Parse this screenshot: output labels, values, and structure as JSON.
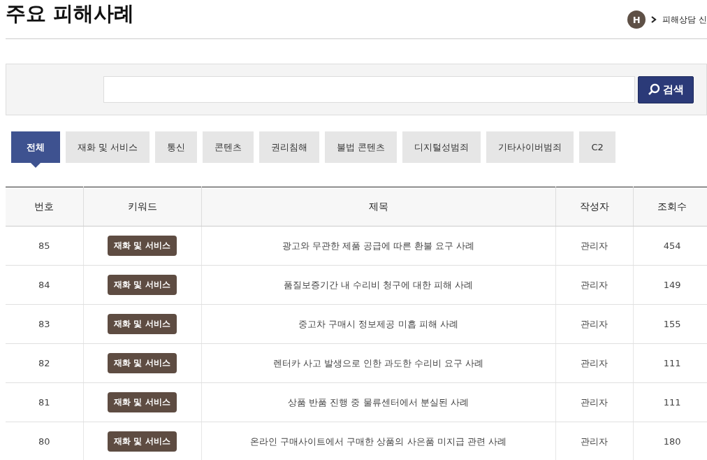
{
  "title": "주요 피해사례",
  "breadcrumb": {
    "home_letter": "H",
    "current": "피해상담 신"
  },
  "search": {
    "button": "검색"
  },
  "tabs": [
    {
      "label": "전체",
      "selected": true
    },
    {
      "label": "재화 및 서비스",
      "selected": false
    },
    {
      "label": "통신",
      "selected": false
    },
    {
      "label": "콘텐츠",
      "selected": false
    },
    {
      "label": "권리침해",
      "selected": false
    },
    {
      "label": "불법 콘텐츠",
      "selected": false
    },
    {
      "label": "디지털성범죄",
      "selected": false
    },
    {
      "label": "기타사이버범죄",
      "selected": false
    },
    {
      "label": "C2",
      "selected": false
    }
  ],
  "table": {
    "columns": [
      "번호",
      "키워드",
      "제목",
      "작성자",
      "조회수"
    ],
    "rows": [
      {
        "no": "85",
        "keyword": "재화 및 서비스",
        "title": "광고와 무관한 제품 공급에 따른 환불 요구 사례",
        "author": "관리자",
        "views": "454"
      },
      {
        "no": "84",
        "keyword": "재화 및 서비스",
        "title": "품질보증기간 내 수리비 청구에 대한 피해 사례",
        "author": "관리자",
        "views": "149"
      },
      {
        "no": "83",
        "keyword": "재화 및 서비스",
        "title": "중고차 구매시 정보제공 미흡 피해 사례",
        "author": "관리자",
        "views": "155"
      },
      {
        "no": "82",
        "keyword": "재화 및 서비스",
        "title": "렌터카 사고 발생으로 인한 과도한 수리비 요구 사례",
        "author": "관리자",
        "views": "111"
      },
      {
        "no": "81",
        "keyword": "재화 및 서비스",
        "title": "상품 반품 진행 중 물류센터에서 분실된 사례",
        "author": "관리자",
        "views": "111"
      },
      {
        "no": "80",
        "keyword": "재화 및 서비스",
        "title": "온라인 구매사이트에서 구매한 상품의 사은품 미지급 관련 사례",
        "author": "관리자",
        "views": "180"
      }
    ]
  }
}
